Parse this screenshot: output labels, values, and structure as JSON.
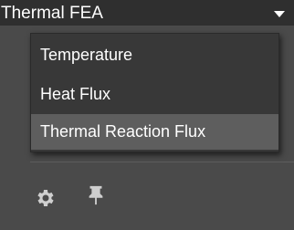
{
  "header": {
    "title": "Thermal FEA",
    "caret_icon": "caret-down-icon"
  },
  "menu": {
    "items": [
      {
        "label": "Temperature",
        "highlighted": false
      },
      {
        "label": "Heat Flux",
        "highlighted": false
      },
      {
        "label": "Thermal Reaction Flux",
        "highlighted": true
      }
    ]
  },
  "toolbar": {
    "icons": [
      "gear-icon",
      "pin-icon"
    ]
  },
  "colors": {
    "panel_bg": "#4a4a4a",
    "header_bg": "#2f2f2f",
    "dropdown_bg": "#383838",
    "highlight_bg": "#5e5e5e",
    "text": "#ffffff",
    "icon": "#cfcfcf"
  }
}
